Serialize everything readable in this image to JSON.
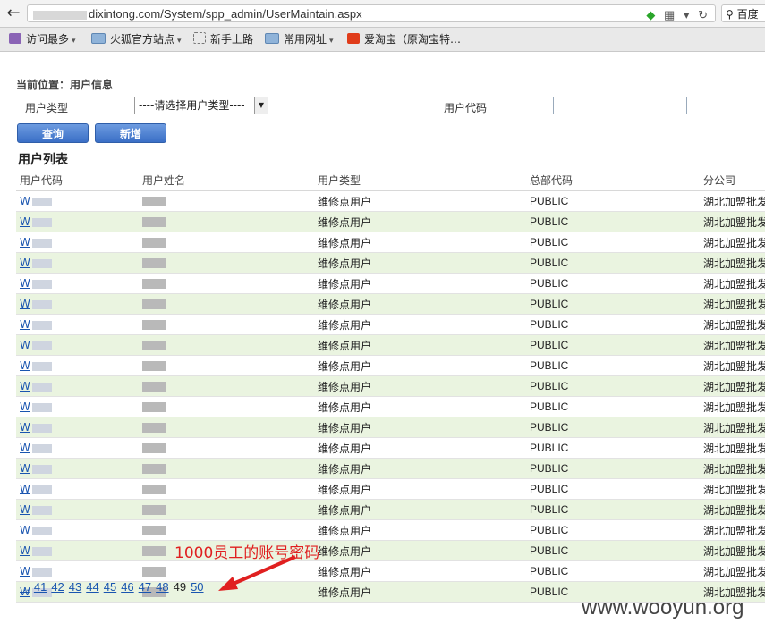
{
  "browser": {
    "url_domain": "dixintong.com",
    "url_path": "/System/spp_admin/UserMaintain.aspx",
    "search_placeholder": "百度",
    "bookmarks": [
      {
        "label": "访问最多",
        "icon": "purple",
        "caret": true
      },
      {
        "label": "火狐官方站点",
        "icon": "folder",
        "caret": true
      },
      {
        "label": "新手上路",
        "icon": "dash",
        "caret": false
      },
      {
        "label": "常用网址",
        "icon": "folder",
        "caret": true
      },
      {
        "label": "爱淘宝（原淘宝特…",
        "icon": "taobao",
        "caret": false
      }
    ]
  },
  "page": {
    "location_label": "当前位置：用户信息",
    "user_type_label": "用户类型",
    "user_type_selected": "----请选择用户类型----",
    "user_code_label": "用户代码",
    "user_code_value": "",
    "search_button": "查询",
    "add_button": "新增",
    "list_title": "用户列表"
  },
  "table": {
    "headers": [
      "用户代码",
      "用户姓名",
      "用户类型",
      "总部代码",
      "分公司"
    ],
    "rows": [
      {
        "code": "W",
        "type": "维修点用户",
        "hq": "PUBLIC",
        "branch": "湖北加盟批发"
      },
      {
        "code": "W",
        "type": "维修点用户",
        "hq": "PUBLIC",
        "branch": "湖北加盟批发"
      },
      {
        "code": "W",
        "type": "维修点用户",
        "hq": "PUBLIC",
        "branch": "湖北加盟批发"
      },
      {
        "code": "W",
        "type": "维修点用户",
        "hq": "PUBLIC",
        "branch": "湖北加盟批发"
      },
      {
        "code": "W",
        "type": "维修点用户",
        "hq": "PUBLIC",
        "branch": "湖北加盟批发"
      },
      {
        "code": "W",
        "type": "维修点用户",
        "hq": "PUBLIC",
        "branch": "湖北加盟批发"
      },
      {
        "code": "W",
        "type": "维修点用户",
        "hq": "PUBLIC",
        "branch": "湖北加盟批发"
      },
      {
        "code": "W",
        "type": "维修点用户",
        "hq": "PUBLIC",
        "branch": "湖北加盟批发"
      },
      {
        "code": "W",
        "type": "维修点用户",
        "hq": "PUBLIC",
        "branch": "湖北加盟批发"
      },
      {
        "code": "W",
        "type": "维修点用户",
        "hq": "PUBLIC",
        "branch": "湖北加盟批发"
      },
      {
        "code": "W",
        "type": "维修点用户",
        "hq": "PUBLIC",
        "branch": "湖北加盟批发"
      },
      {
        "code": "W",
        "type": "维修点用户",
        "hq": "PUBLIC",
        "branch": "湖北加盟批发"
      },
      {
        "code": "W",
        "type": "维修点用户",
        "hq": "PUBLIC",
        "branch": "湖北加盟批发"
      },
      {
        "code": "W",
        "type": "维修点用户",
        "hq": "PUBLIC",
        "branch": "湖北加盟批发"
      },
      {
        "code": "W",
        "type": "维修点用户",
        "hq": "PUBLIC",
        "branch": "湖北加盟批发"
      },
      {
        "code": "W",
        "type": "维修点用户",
        "hq": "PUBLIC",
        "branch": "湖北加盟批发"
      },
      {
        "code": "W",
        "type": "维修点用户",
        "hq": "PUBLIC",
        "branch": "湖北加盟批发"
      },
      {
        "code": "W",
        "type": "维修点用户",
        "hq": "PUBLIC",
        "branch": "湖北加盟批发"
      },
      {
        "code": "W",
        "type": "维修点用户",
        "hq": "PUBLIC",
        "branch": "湖北加盟批发"
      },
      {
        "code": "W",
        "type": "维修点用户",
        "hq": "PUBLIC",
        "branch": "湖北加盟批发"
      }
    ]
  },
  "pager": {
    "pages": [
      "...",
      "41",
      "42",
      "43",
      "44",
      "45",
      "46",
      "47",
      "48",
      "49",
      "50"
    ],
    "current": "49"
  },
  "annotation": {
    "text": "1000员工的账号密码",
    "color": "#e02020"
  },
  "watermark": "www.wooyun.org"
}
